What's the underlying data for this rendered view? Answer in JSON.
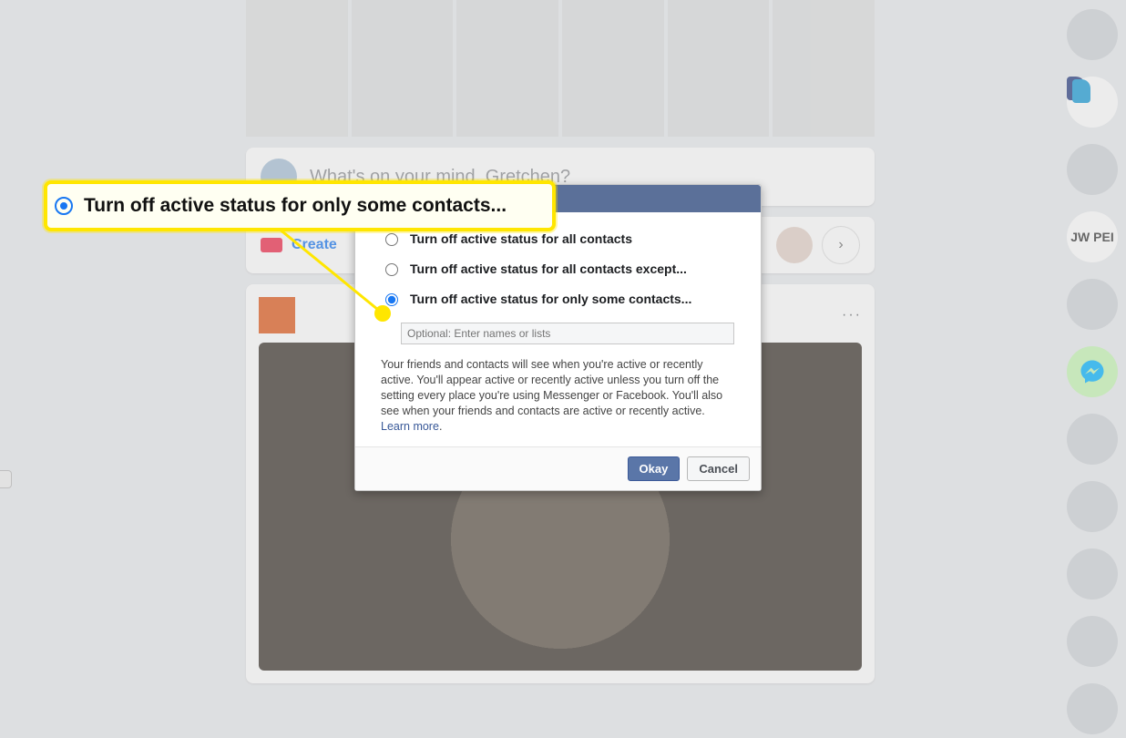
{
  "composer": {
    "placeholder": "What's on your mind, Gretchen?"
  },
  "rooms": {
    "create_label": "Create"
  },
  "modal": {
    "options": {
      "all": "Turn off active status for all contacts",
      "except": "Turn off active status for all contacts except...",
      "some": "Turn off active status for only some contacts..."
    },
    "names_placeholder": "Optional: Enter names or lists",
    "description": "Your friends and contacts will see when you're active or recently active. You'll appear active or recently active unless you turn off the setting every place you're using Messenger or Facebook. You'll also see when your friends and contacts are active or recently active. ",
    "learn_more": "Learn more",
    "okay": "Okay",
    "cancel": "Cancel"
  },
  "callout": {
    "label": "Turn off active status for only some contacts..."
  },
  "contacts": {
    "jw_label": "JW PEI"
  },
  "post": {
    "more": "···"
  }
}
